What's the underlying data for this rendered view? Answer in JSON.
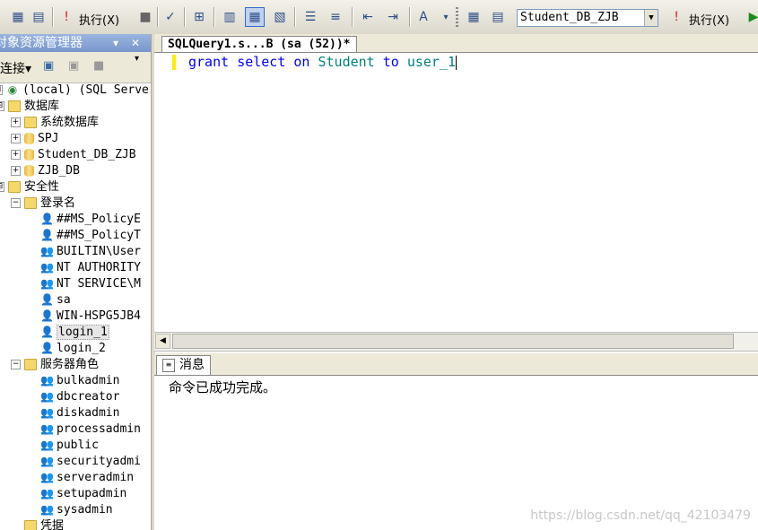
{
  "toolbar": {
    "execute_label_1": "执行(X)",
    "execute_label_2": "执行(X)",
    "database_selected": "Student_DB_ZJB"
  },
  "object_explorer": {
    "title": "对象资源管理器",
    "pin_glyph": "▾",
    "close_glyph": "✕",
    "connect_label": "连接▾",
    "tree": [
      {
        "label": "(local) (SQL Server",
        "expander": "⊟",
        "icon": "server-icon"
      },
      {
        "label": "数据库",
        "expander": "⊟",
        "icon": "folder-icon"
      },
      {
        "label": "系统数据库",
        "expander": "+",
        "icon": "folder-icon"
      },
      {
        "label": "SPJ",
        "expander": "+",
        "icon": "database-icon"
      },
      {
        "label": "Student_DB_ZJB",
        "expander": "+",
        "icon": "database-icon"
      },
      {
        "label": "ZJB_DB",
        "expander": "+",
        "icon": "database-icon"
      },
      {
        "label": "安全性",
        "expander": "⊟",
        "icon": "folder-icon"
      },
      {
        "label": "登录名",
        "expander": "−",
        "icon": "folder-icon"
      },
      {
        "label": "##MS_PolicyE",
        "icon": "login-disabled-icon"
      },
      {
        "label": "##MS_PolicyT",
        "icon": "login-disabled-icon"
      },
      {
        "label": "BUILTIN\\User",
        "icon": "group-login-icon"
      },
      {
        "label": "NT AUTHORITY",
        "icon": "group-login-icon"
      },
      {
        "label": "NT SERVICE\\M",
        "icon": "group-login-icon"
      },
      {
        "label": "sa",
        "icon": "login-icon"
      },
      {
        "label": "WIN-HSPG5JB4",
        "icon": "login-icon"
      },
      {
        "label": "login_1",
        "icon": "login-icon",
        "selected": true
      },
      {
        "label": "login_2",
        "icon": "login-icon"
      },
      {
        "label": "服务器角色",
        "expander": "−",
        "icon": "folder-icon"
      },
      {
        "label": "bulkadmin",
        "icon": "role-icon"
      },
      {
        "label": "dbcreator",
        "icon": "role-icon"
      },
      {
        "label": "diskadmin",
        "icon": "role-icon"
      },
      {
        "label": "processadmin",
        "icon": "role-icon"
      },
      {
        "label": "public",
        "icon": "role-icon"
      },
      {
        "label": "securityadmi",
        "icon": "role-icon"
      },
      {
        "label": "serveradmin",
        "icon": "role-icon"
      },
      {
        "label": "setupadmin",
        "icon": "role-icon"
      },
      {
        "label": "sysadmin",
        "icon": "role-icon"
      },
      {
        "label": "凭据",
        "icon": "folder-icon"
      }
    ]
  },
  "editor": {
    "tab_title": "SQLQuery1.s...B (sa (52))*",
    "code": {
      "kw1": "grant",
      "kw2": "select",
      "kw3": "on",
      "table": "Student",
      "kw4": "to",
      "user": "user_1"
    }
  },
  "messages": {
    "tab_label": "消息",
    "text": "命令已成功完成。"
  },
  "watermark": "https://blog.csdn.net/qq_42103479",
  "colors": {
    "keyword": "#0000ff",
    "identifier": "#008080",
    "title_bar": "#7796cc"
  }
}
